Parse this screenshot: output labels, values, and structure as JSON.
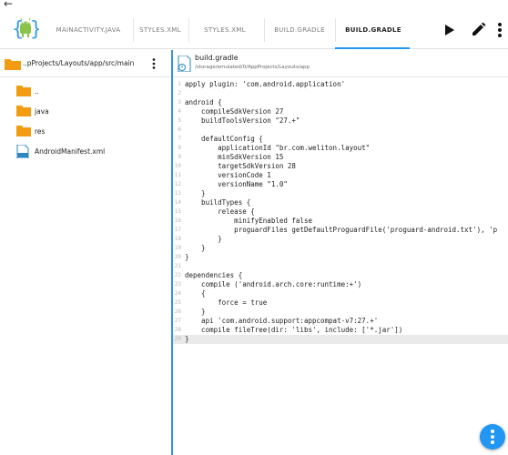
{
  "tabs": [
    {
      "label": "MAINACTIVITY.JAVA",
      "active": false
    },
    {
      "label": "STYLES.XML",
      "active": false
    },
    {
      "label": "STYLES.XML",
      "active": false
    },
    {
      "label": "BUILD.GRADLE",
      "active": false
    },
    {
      "label": "BUILD.GRADLE",
      "active": true
    }
  ],
  "toolbar": {
    "icons": [
      "play-icon",
      "pencil-icon",
      "more-vertical-icon"
    ]
  },
  "sidebar": {
    "path": "..pProjects/Layouts/app/src/main",
    "items": [
      {
        "name": "..",
        "type": "folder"
      },
      {
        "name": "java",
        "type": "folder"
      },
      {
        "name": "res",
        "type": "folder"
      },
      {
        "name": "AndroidManifest.xml",
        "type": "xml-file"
      }
    ]
  },
  "editor": {
    "file_name": "build.gradle",
    "file_path": "/storage/emulated/0/AppProjects/Layouts/app",
    "current_line": 29,
    "lines": [
      "apply plugin: 'com.android.application'",
      "",
      "android {",
      "    compileSdkVersion 27",
      "    buildToolsVersion \"27.+\"",
      "",
      "    defaultConfig {",
      "        applicationId \"br.com.weliton.layout\"",
      "        minSdkVersion 15",
      "        targetSdkVersion 28",
      "        versionCode 1",
      "        versionName \"1.0\"",
      "    }",
      "    buildTypes {",
      "        release {",
      "            minifyEnabled false",
      "            proguardFiles getDefaultProguardFile('proguard-android.txt'), 'p",
      "        }",
      "    }",
      "}",
      "",
      "dependencies {",
      "    compile ('android.arch.core:runtime:+')",
      "    {",
      "        force = true",
      "    }",
      "    api 'com.android.support:appcompat-v7:27.+'",
      "    compile fileTree(dir: 'libs', include: ['*.jar'])",
      "}"
    ]
  },
  "colors": {
    "accent": "#2196f3",
    "folder": "#f39c12",
    "divider": "#3d8fd8",
    "line_highlight": "#eaeaea"
  }
}
